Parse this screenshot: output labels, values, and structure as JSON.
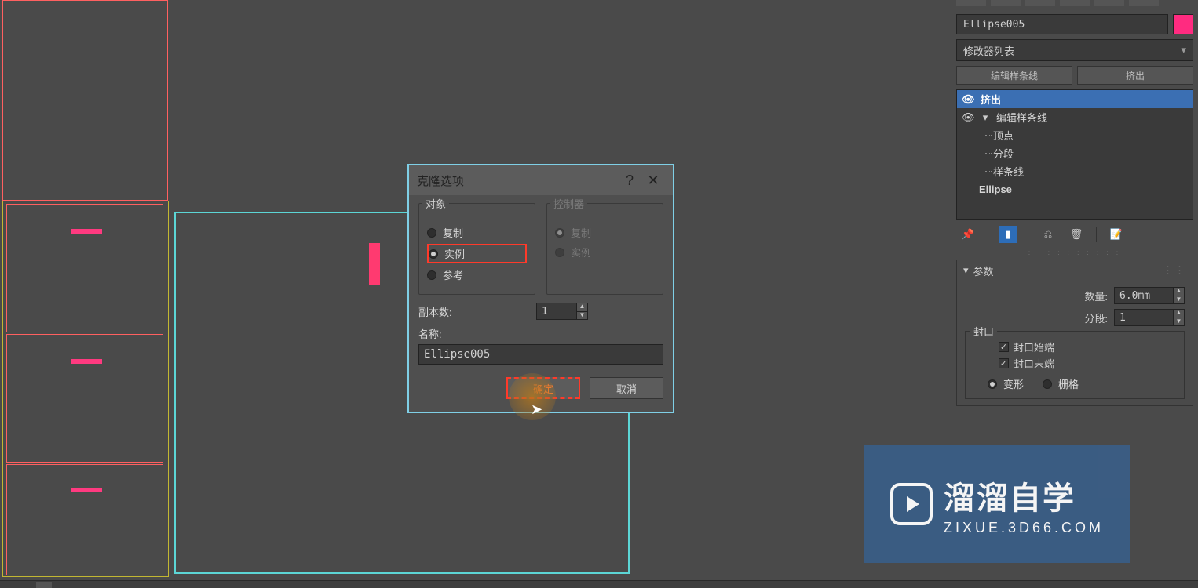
{
  "dialog": {
    "title": "克隆选项",
    "help": "?",
    "close": "✕",
    "object_group": "对象",
    "controller_group": "控制器",
    "opt_copy": "复制",
    "opt_instance": "实例",
    "opt_reference": "参考",
    "ctrl_copy": "复制",
    "ctrl_instance": "实例",
    "copies_label": "副本数:",
    "copies_value": "1",
    "name_label": "名称:",
    "name_value": "Ellipse005",
    "ok": "确定",
    "cancel": "取消"
  },
  "right_panel": {
    "object_name": "Ellipse005",
    "modifier_list": "修改器列表",
    "btn_editspline": "编辑样条线",
    "btn_extrude": "挤出",
    "stack": {
      "extrude": "挤出",
      "editspline": "编辑样条线",
      "vertex": "顶点",
      "segment": "分段",
      "spline": "样条线",
      "base": "Ellipse"
    },
    "rollout": {
      "title": "参数",
      "amount_label": "数量:",
      "amount_value": "6.0mm",
      "segments_label": "分段:",
      "segments_value": "1",
      "cap_group": "封口",
      "cap_start": "封口始端",
      "cap_end": "封口末端",
      "morph": "变形",
      "grid": "栅格"
    }
  },
  "watermark": {
    "line1": "溜溜自学",
    "line2": "ZIXUE.3D66.COM"
  }
}
